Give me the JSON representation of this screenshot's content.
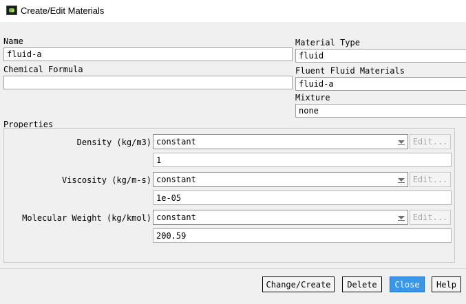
{
  "window": {
    "title": "Create/Edit Materials"
  },
  "form": {
    "name_label": "Name",
    "name_value": "fluid-a",
    "chemical_formula_label": "Chemical Formula",
    "chemical_formula_value": "",
    "material_type_label": "Material Type",
    "material_type_value": "fluid",
    "fluent_materials_label": "Fluent Fluid Materials",
    "fluent_materials_value": "fluid-a",
    "mixture_label": "Mixture",
    "mixture_value": "none"
  },
  "properties": {
    "label": "Properties",
    "rows": [
      {
        "label": "Density (kg/m3)",
        "method": "constant",
        "edit_label": "Edit...",
        "value": "1"
      },
      {
        "label": "Viscosity (kg/m-s)",
        "method": "constant",
        "edit_label": "Edit...",
        "value": "1e-05"
      },
      {
        "label": "Molecular Weight (kg/kmol)",
        "method": "constant",
        "edit_label": "Edit...",
        "value": "200.59"
      }
    ]
  },
  "buttons": {
    "change_create": "Change/Create",
    "delete": "Delete",
    "close": "Close",
    "help": "Help"
  },
  "colors": {
    "primary_button": "#3c96e6",
    "app_icon_green": "#6fc13a"
  },
  "icons": {
    "app": "fluent-app-icon",
    "dropdown": "chevron-down-icon"
  }
}
